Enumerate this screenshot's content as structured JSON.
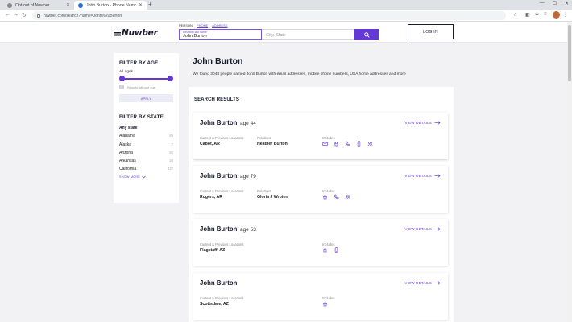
{
  "browser": {
    "tabs": [
      {
        "title": "Opt-out of Nuwber"
      },
      {
        "title": "John Burton - Phone Number a"
      }
    ],
    "url": "nuwber.com/search?name=John%20Burton"
  },
  "header": {
    "logo": "Nuwber",
    "search_tabs": [
      "PERSON",
      "PHONE",
      "ADDRESS"
    ],
    "name_field": {
      "label": "First and last name",
      "value": "John Burton"
    },
    "city_placeholder": "City, State",
    "login_label": "LOG IN"
  },
  "sidebar": {
    "age_title": "FILTER BY AGE",
    "age_value": "All ages",
    "age_range": [
      0,
      1
    ],
    "results_without_age": "Results without age",
    "apply_label": "APPLY",
    "state_title": "FILTER BY STATE",
    "states": [
      {
        "name": "Any state",
        "count": ""
      },
      {
        "name": "Alabama",
        "count": "69"
      },
      {
        "name": "Alaska",
        "count": "7"
      },
      {
        "name": "Arizona",
        "count": "60"
      },
      {
        "name": "Arkansas",
        "count": "26"
      },
      {
        "name": "California",
        "count": "237"
      }
    ],
    "show_more": "SHOW MORE"
  },
  "main": {
    "name": "John Burton",
    "description": "We found 3048 people named John Burton with email addresses, mobile phone numbers, USA home addresses and more",
    "results_title": "SEARCH RESULTS",
    "locations_label": "Current & Previous Locations",
    "relatives_label": "Relatives",
    "includes_label": "Includes",
    "view_details": "VIEW DETAILS",
    "results": [
      {
        "name": "John Burton",
        "age": ", age 44",
        "location": "Cabot, AR",
        "relatives": "Heather Burton",
        "includes": [
          "email-icon",
          "home-icon",
          "phone-icon",
          "mobile-icon",
          "people-icon"
        ]
      },
      {
        "name": "John Burton",
        "age": ", age 79",
        "location": "Rogers, AR",
        "relatives": "Gloria J Wroten",
        "includes": [
          "home-icon",
          "phone-icon",
          "people-icon"
        ]
      },
      {
        "name": "John Burton",
        "age": ", age 53",
        "location": "Flagstaff, AZ",
        "relatives": "",
        "includes": [
          "home-icon",
          "mobile-icon"
        ]
      },
      {
        "name": "John Burton",
        "age": "",
        "location": "Scottsdale, AZ",
        "relatives": "",
        "includes": [
          "home-icon"
        ]
      }
    ]
  },
  "colors": {
    "accent": "#6438d6",
    "dark": "#1b1b2e"
  }
}
